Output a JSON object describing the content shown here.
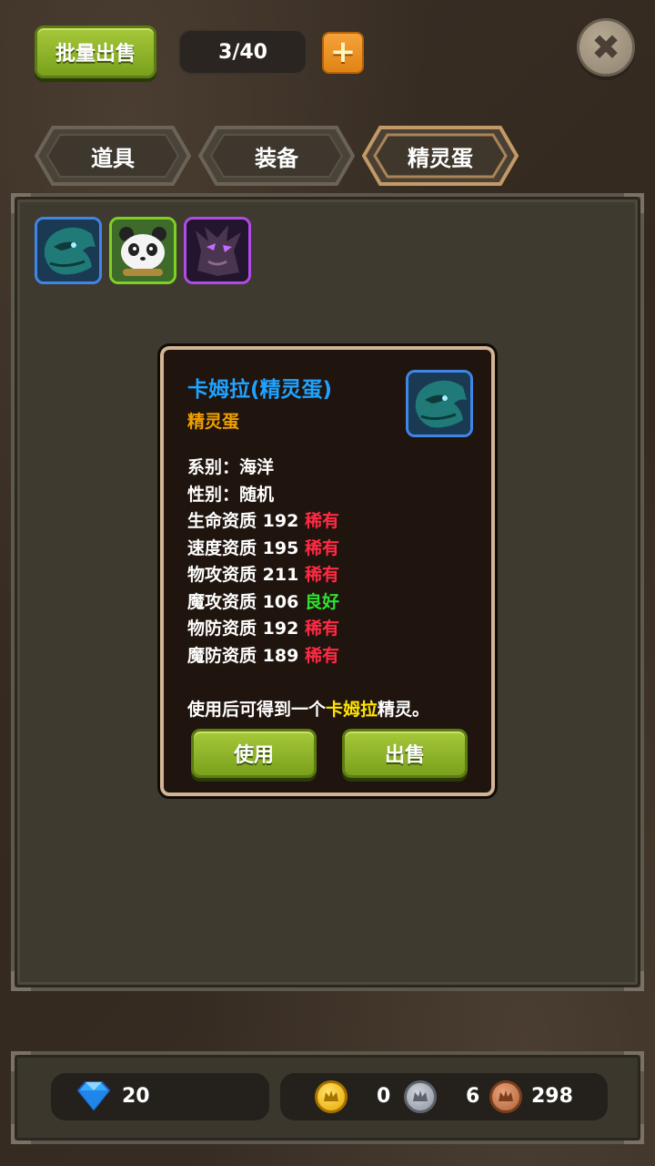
{
  "header": {
    "bulk_sell_label": "批量出售",
    "slot_count": "3/40",
    "add_symbol": "+",
    "close_symbol": "✖"
  },
  "tabs": [
    {
      "label": "道具",
      "active": false
    },
    {
      "label": "装备",
      "active": false
    },
    {
      "label": "精灵蛋",
      "active": true
    }
  ],
  "inventory": {
    "slots": [
      {
        "icon": "teal-dragon-egg-icon",
        "rarity_color": "#3f86e8"
      },
      {
        "icon": "panda-egg-icon",
        "rarity_color": "#7ed024"
      },
      {
        "icon": "dark-beast-egg-icon",
        "rarity_color": "#b14be8"
      }
    ]
  },
  "popup": {
    "title": "卡姆拉(精灵蛋)",
    "type": "精灵蛋",
    "series_label": "系别：",
    "series_value": "海洋",
    "gender_label": "性别：",
    "gender_value": "随机",
    "stats": [
      {
        "label": "生命资质",
        "value": "192",
        "grade": "稀有",
        "grade_color": "#ff2a44"
      },
      {
        "label": "速度资质",
        "value": "195",
        "grade": "稀有",
        "grade_color": "#ff2a44"
      },
      {
        "label": "物攻资质",
        "value": "211",
        "grade": "稀有",
        "grade_color": "#ff2a44"
      },
      {
        "label": "魔攻资质",
        "value": "106",
        "grade": "良好",
        "grade_color": "#2fe12f"
      },
      {
        "label": "物防资质",
        "value": "192",
        "grade": "稀有",
        "grade_color": "#ff2a44"
      },
      {
        "label": "魔防资质",
        "value": "189",
        "grade": "稀有",
        "grade_color": "#ff2a44"
      }
    ],
    "desc_prefix": "使用后可得到一个",
    "desc_highlight": "卡姆拉",
    "desc_suffix": "精灵。",
    "use_label": "使用",
    "sell_label": "出售"
  },
  "currency": {
    "gems": "20",
    "gold": "0",
    "silver": "6",
    "bronze": "298"
  }
}
